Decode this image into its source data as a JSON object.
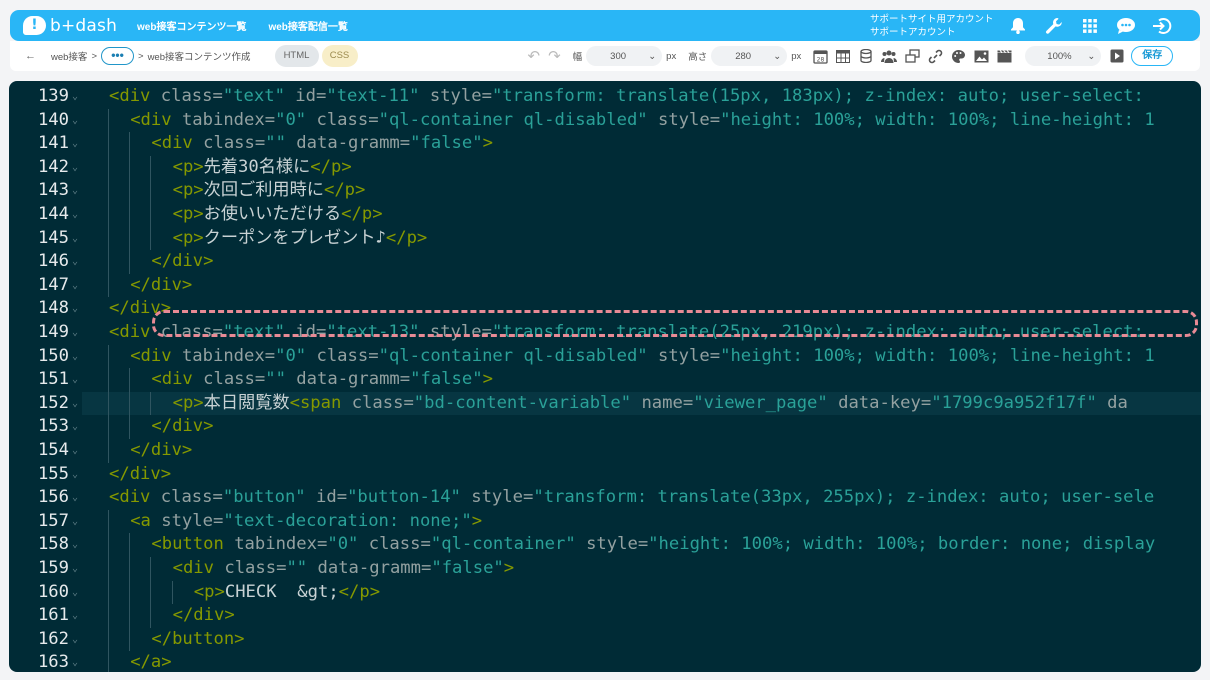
{
  "app": {
    "logo_text": "b+dash",
    "nav": [
      "web接客コンテンツ一覧",
      "web接客配信一覧"
    ],
    "account_line1": "サポートサイト用アカウント",
    "account_line2": "サポートアカウント",
    "icons": [
      "bell-icon",
      "wrench-icon",
      "grid-icon",
      "chat-icon",
      "logout-icon"
    ]
  },
  "toolbar": {
    "back_glyph": "←",
    "breadcrumb_root": "web接客",
    "breadcrumb_sep": ">",
    "more_label": "•••",
    "breadcrumb_current": "web接客コンテンツ作成",
    "tab_html": "HTML",
    "tab_css": "CSS",
    "width_label": "幅",
    "width_value": "300",
    "height_label": "高さ",
    "height_value": "280",
    "unit": "px",
    "zoom_value": "100%",
    "save_label": "保存"
  },
  "editor": {
    "active_line": 152,
    "lines": [
      {
        "n": "139",
        "indent": 1,
        "tokens": [
          [
            "tag",
            "<div "
          ],
          [
            "attr",
            "class"
          ],
          [
            "eq",
            "="
          ],
          [
            "str",
            "\"text\""
          ],
          [
            "attr",
            " id"
          ],
          [
            "eq",
            "="
          ],
          [
            "str",
            "\"text-11\""
          ],
          [
            "attr",
            " style"
          ],
          [
            "eq",
            "="
          ],
          [
            "str",
            "\"transform: translate(15px, 183px); z-index: auto; user-select: "
          ]
        ]
      },
      {
        "n": "140",
        "indent": 2,
        "tokens": [
          [
            "tag",
            "<div "
          ],
          [
            "attr",
            "tabindex"
          ],
          [
            "eq",
            "="
          ],
          [
            "str",
            "\"0\""
          ],
          [
            "attr",
            " class"
          ],
          [
            "eq",
            "="
          ],
          [
            "str",
            "\"ql-container ql-disabled\""
          ],
          [
            "attr",
            " style"
          ],
          [
            "eq",
            "="
          ],
          [
            "str",
            "\"height: 100%; width: 100%; line-height: 1"
          ]
        ]
      },
      {
        "n": "141",
        "indent": 3,
        "tokens": [
          [
            "tag",
            "<div "
          ],
          [
            "attr",
            "class"
          ],
          [
            "eq",
            "="
          ],
          [
            "str",
            "\"\""
          ],
          [
            "attr",
            " data-gramm"
          ],
          [
            "eq",
            "="
          ],
          [
            "str",
            "\"false\""
          ],
          [
            "tag",
            ">"
          ]
        ]
      },
      {
        "n": "142",
        "indent": 4,
        "tokens": [
          [
            "tag",
            "<p>"
          ],
          [
            "txt",
            "先着30名様に"
          ],
          [
            "tag",
            "</p>"
          ]
        ]
      },
      {
        "n": "143",
        "indent": 4,
        "tokens": [
          [
            "tag",
            "<p>"
          ],
          [
            "txt",
            "次回ご利用時に"
          ],
          [
            "tag",
            "</p>"
          ]
        ]
      },
      {
        "n": "144",
        "indent": 4,
        "tokens": [
          [
            "tag",
            "<p>"
          ],
          [
            "txt",
            "お使いいただける"
          ],
          [
            "tag",
            "</p>"
          ]
        ]
      },
      {
        "n": "145",
        "indent": 4,
        "tokens": [
          [
            "tag",
            "<p>"
          ],
          [
            "txt",
            "クーポンをプレゼント♪"
          ],
          [
            "tag",
            "</p>"
          ]
        ]
      },
      {
        "n": "146",
        "indent": 3,
        "tokens": [
          [
            "tag",
            "</div>"
          ]
        ]
      },
      {
        "n": "147",
        "indent": 2,
        "tokens": [
          [
            "tag",
            "</div>"
          ]
        ]
      },
      {
        "n": "148",
        "indent": 1,
        "tokens": [
          [
            "tag",
            "</div>"
          ]
        ]
      },
      {
        "n": "149",
        "indent": 1,
        "tokens": [
          [
            "tag",
            "<div "
          ],
          [
            "attr",
            "class"
          ],
          [
            "eq",
            "="
          ],
          [
            "str",
            "\"text\""
          ],
          [
            "attr",
            " id"
          ],
          [
            "eq",
            "="
          ],
          [
            "str",
            "\"text-13\""
          ],
          [
            "attr",
            " style"
          ],
          [
            "eq",
            "="
          ],
          [
            "str",
            "\"transform: translate(25px, 219px); z-index: auto; user-select: "
          ]
        ]
      },
      {
        "n": "150",
        "indent": 2,
        "tokens": [
          [
            "tag",
            "<div "
          ],
          [
            "attr",
            "tabindex"
          ],
          [
            "eq",
            "="
          ],
          [
            "str",
            "\"0\""
          ],
          [
            "attr",
            " class"
          ],
          [
            "eq",
            "="
          ],
          [
            "str",
            "\"ql-container ql-disabled\""
          ],
          [
            "attr",
            " style"
          ],
          [
            "eq",
            "="
          ],
          [
            "str",
            "\"height: 100%; width: 100%; line-height: 1"
          ]
        ]
      },
      {
        "n": "151",
        "indent": 3,
        "tokens": [
          [
            "tag",
            "<div "
          ],
          [
            "attr",
            "class"
          ],
          [
            "eq",
            "="
          ],
          [
            "str",
            "\"\""
          ],
          [
            "attr",
            " data-gramm"
          ],
          [
            "eq",
            "="
          ],
          [
            "str",
            "\"false\""
          ],
          [
            "tag",
            ">"
          ]
        ]
      },
      {
        "n": "152",
        "indent": 4,
        "tokens": [
          [
            "tag",
            "<p>"
          ],
          [
            "txt",
            "本日閲覧数"
          ],
          [
            "tag",
            "<span "
          ],
          [
            "attr",
            "class"
          ],
          [
            "eq",
            "="
          ],
          [
            "str",
            "\"bd-content-variable\""
          ],
          [
            "attr",
            " name"
          ],
          [
            "eq",
            "="
          ],
          [
            "str",
            "\"viewer_page\""
          ],
          [
            "attr",
            " data-key"
          ],
          [
            "eq",
            "="
          ],
          [
            "str",
            "\"1799c9a952f17f\""
          ],
          [
            "attr",
            " da"
          ]
        ]
      },
      {
        "n": "153",
        "indent": 3,
        "tokens": [
          [
            "tag",
            "</div>"
          ]
        ]
      },
      {
        "n": "154",
        "indent": 2,
        "tokens": [
          [
            "tag",
            "</div>"
          ]
        ]
      },
      {
        "n": "155",
        "indent": 1,
        "tokens": [
          [
            "tag",
            "</div>"
          ]
        ]
      },
      {
        "n": "156",
        "indent": 1,
        "tokens": [
          [
            "tag",
            "<div "
          ],
          [
            "attr",
            "class"
          ],
          [
            "eq",
            "="
          ],
          [
            "str",
            "\"button\""
          ],
          [
            "attr",
            " id"
          ],
          [
            "eq",
            "="
          ],
          [
            "str",
            "\"button-14\""
          ],
          [
            "attr",
            " style"
          ],
          [
            "eq",
            "="
          ],
          [
            "str",
            "\"transform: translate(33px, 255px); z-index: auto; user-sele"
          ]
        ]
      },
      {
        "n": "157",
        "indent": 2,
        "tokens": [
          [
            "tag",
            "<a "
          ],
          [
            "attr",
            "style"
          ],
          [
            "eq",
            "="
          ],
          [
            "str",
            "\"text-decoration: none;\""
          ],
          [
            "tag",
            ">"
          ]
        ]
      },
      {
        "n": "158",
        "indent": 3,
        "tokens": [
          [
            "tag",
            "<button "
          ],
          [
            "attr",
            "tabindex"
          ],
          [
            "eq",
            "="
          ],
          [
            "str",
            "\"0\""
          ],
          [
            "attr",
            " class"
          ],
          [
            "eq",
            "="
          ],
          [
            "str",
            "\"ql-container\""
          ],
          [
            "attr",
            " style"
          ],
          [
            "eq",
            "="
          ],
          [
            "str",
            "\"height: 100%; width: 100%; border: none; display"
          ]
        ]
      },
      {
        "n": "159",
        "indent": 4,
        "tokens": [
          [
            "tag",
            "<div "
          ],
          [
            "attr",
            "class"
          ],
          [
            "eq",
            "="
          ],
          [
            "str",
            "\"\""
          ],
          [
            "attr",
            " data-gramm"
          ],
          [
            "eq",
            "="
          ],
          [
            "str",
            "\"false\""
          ],
          [
            "tag",
            ">"
          ]
        ]
      },
      {
        "n": "160",
        "indent": 5,
        "tokens": [
          [
            "tag",
            "<p>"
          ],
          [
            "txt",
            "CHECK  &gt;"
          ],
          [
            "tag",
            "</p>"
          ]
        ]
      },
      {
        "n": "161",
        "indent": 4,
        "tokens": [
          [
            "tag",
            "</div>"
          ]
        ]
      },
      {
        "n": "162",
        "indent": 3,
        "tokens": [
          [
            "tag",
            "</button>"
          ]
        ]
      },
      {
        "n": "163",
        "indent": 2,
        "tokens": [
          [
            "tag",
            "</a>"
          ]
        ]
      }
    ]
  }
}
